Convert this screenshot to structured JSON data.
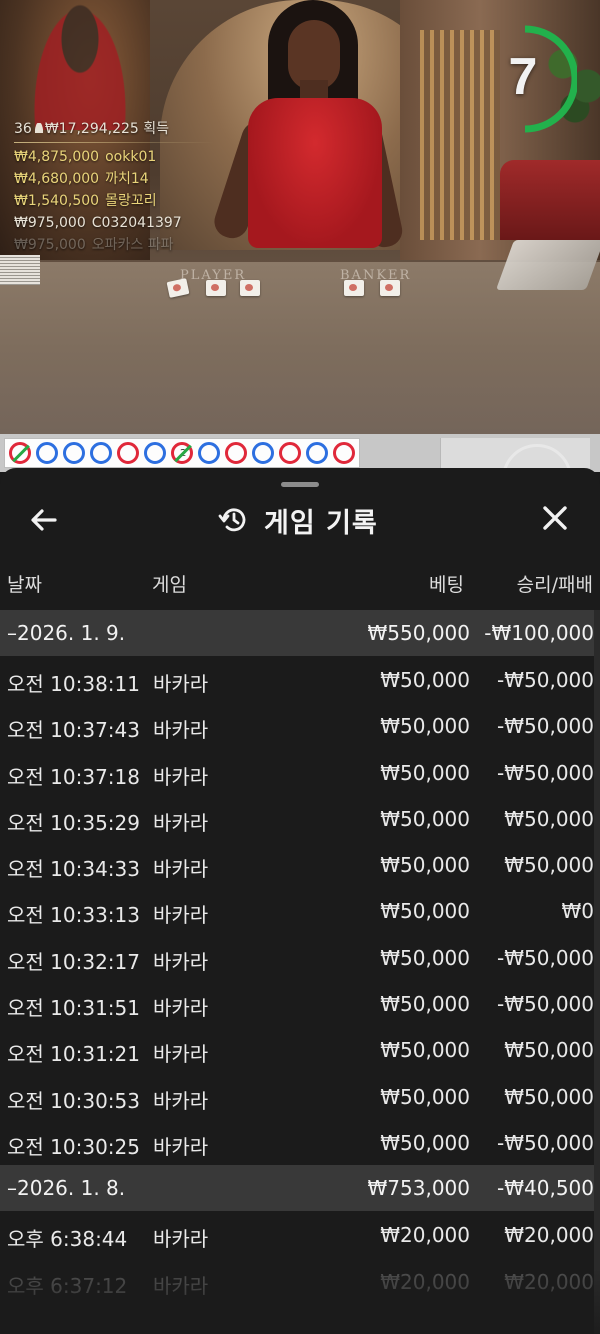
{
  "live": {
    "table_labels": {
      "player": "PLAYER",
      "banker": "BANKER"
    },
    "timer_value": "7",
    "timer_color": "#22b14c",
    "winners": {
      "count": "36",
      "total": "₩17,294,225",
      "total_suffix": "획득",
      "list": [
        {
          "amount": "₩4,875,000",
          "name": "ookk01"
        },
        {
          "amount": "₩4,680,000",
          "name": "까치14"
        },
        {
          "amount": "₩1,540,500",
          "name": "몰랑꼬리"
        },
        {
          "amount": "₩975,000",
          "name": "C032041397"
        },
        {
          "amount": "₩975,000",
          "name": "오파카스 파파"
        }
      ]
    }
  },
  "road": {
    "beads": [
      {
        "color": "red",
        "mark": "slash"
      },
      {
        "color": "blue"
      },
      {
        "color": "blue"
      },
      {
        "color": "blue"
      },
      {
        "color": "red"
      },
      {
        "color": "blue"
      },
      {
        "color": "red",
        "mark": "slash",
        "count": "2"
      },
      {
        "color": "blue"
      },
      {
        "color": "red"
      },
      {
        "color": "blue"
      },
      {
        "color": "red"
      },
      {
        "color": "blue"
      },
      {
        "color": "red"
      }
    ]
  },
  "history": {
    "title": "게임 기록",
    "back_icon": "arrow-left-icon",
    "history_icon": "history-icon",
    "close_icon": "close-icon",
    "columns": {
      "date": "날짜",
      "game": "게임",
      "bet": "베팅",
      "result": "승리/패배"
    },
    "groups": [
      {
        "date": "–2026. 1. 9.",
        "bet_total": "₩550,000",
        "result_total": "-₩100,000",
        "rows": [
          {
            "time": "오전 10:38:11",
            "game": "바카라",
            "bet": "₩50,000",
            "result": "-₩50,000"
          },
          {
            "time": "오전 10:37:43",
            "game": "바카라",
            "bet": "₩50,000",
            "result": "-₩50,000"
          },
          {
            "time": "오전 10:37:18",
            "game": "바카라",
            "bet": "₩50,000",
            "result": "-₩50,000"
          },
          {
            "time": "오전 10:35:29",
            "game": "바카라",
            "bet": "₩50,000",
            "result": "₩50,000"
          },
          {
            "time": "오전 10:34:33",
            "game": "바카라",
            "bet": "₩50,000",
            "result": "₩50,000"
          },
          {
            "time": "오전 10:33:13",
            "game": "바카라",
            "bet": "₩50,000",
            "result": "₩0"
          },
          {
            "time": "오전 10:32:17",
            "game": "바카라",
            "bet": "₩50,000",
            "result": "-₩50,000"
          },
          {
            "time": "오전 10:31:51",
            "game": "바카라",
            "bet": "₩50,000",
            "result": "-₩50,000"
          },
          {
            "time": "오전 10:31:21",
            "game": "바카라",
            "bet": "₩50,000",
            "result": "₩50,000"
          },
          {
            "time": "오전 10:30:53",
            "game": "바카라",
            "bet": "₩50,000",
            "result": "₩50,000"
          },
          {
            "time": "오전 10:30:25",
            "game": "바카라",
            "bet": "₩50,000",
            "result": "-₩50,000"
          }
        ]
      },
      {
        "date": "–2026. 1. 8.",
        "bet_total": "₩753,000",
        "result_total": "-₩40,500",
        "rows": [
          {
            "time": "오후 6:38:44",
            "game": "바카라",
            "bet": "₩20,000",
            "result": "₩20,000"
          },
          {
            "time": "오후 6:37:12",
            "game": "바카라",
            "bet": "₩20,000",
            "result": "₩20,000"
          }
        ]
      }
    ]
  }
}
